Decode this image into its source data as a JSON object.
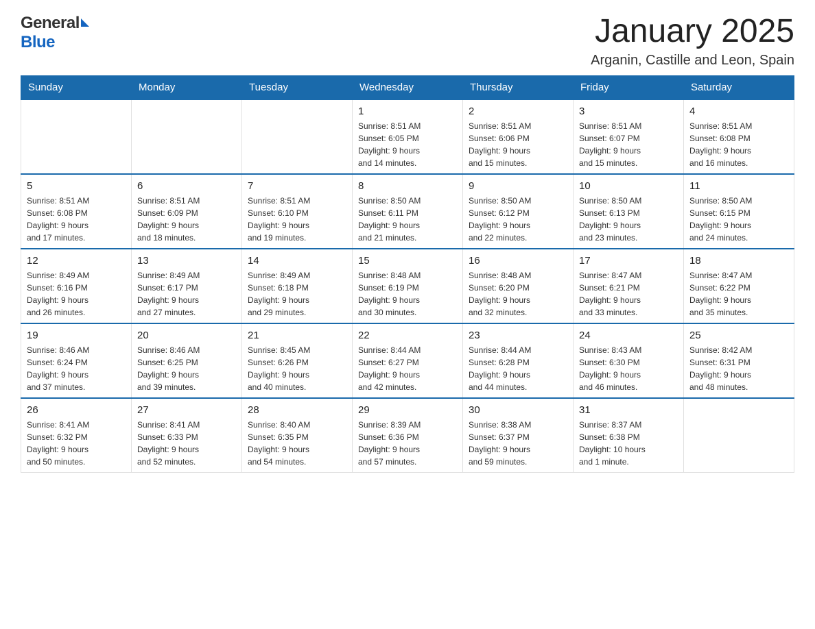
{
  "header": {
    "logo_general": "General",
    "logo_blue": "Blue",
    "title": "January 2025",
    "subtitle": "Arganin, Castille and Leon, Spain"
  },
  "calendar": {
    "days_of_week": [
      "Sunday",
      "Monday",
      "Tuesday",
      "Wednesday",
      "Thursday",
      "Friday",
      "Saturday"
    ],
    "weeks": [
      [
        {
          "day": "",
          "info": ""
        },
        {
          "day": "",
          "info": ""
        },
        {
          "day": "",
          "info": ""
        },
        {
          "day": "1",
          "info": "Sunrise: 8:51 AM\nSunset: 6:05 PM\nDaylight: 9 hours\nand 14 minutes."
        },
        {
          "day": "2",
          "info": "Sunrise: 8:51 AM\nSunset: 6:06 PM\nDaylight: 9 hours\nand 15 minutes."
        },
        {
          "day": "3",
          "info": "Sunrise: 8:51 AM\nSunset: 6:07 PM\nDaylight: 9 hours\nand 15 minutes."
        },
        {
          "day": "4",
          "info": "Sunrise: 8:51 AM\nSunset: 6:08 PM\nDaylight: 9 hours\nand 16 minutes."
        }
      ],
      [
        {
          "day": "5",
          "info": "Sunrise: 8:51 AM\nSunset: 6:08 PM\nDaylight: 9 hours\nand 17 minutes."
        },
        {
          "day": "6",
          "info": "Sunrise: 8:51 AM\nSunset: 6:09 PM\nDaylight: 9 hours\nand 18 minutes."
        },
        {
          "day": "7",
          "info": "Sunrise: 8:51 AM\nSunset: 6:10 PM\nDaylight: 9 hours\nand 19 minutes."
        },
        {
          "day": "8",
          "info": "Sunrise: 8:50 AM\nSunset: 6:11 PM\nDaylight: 9 hours\nand 21 minutes."
        },
        {
          "day": "9",
          "info": "Sunrise: 8:50 AM\nSunset: 6:12 PM\nDaylight: 9 hours\nand 22 minutes."
        },
        {
          "day": "10",
          "info": "Sunrise: 8:50 AM\nSunset: 6:13 PM\nDaylight: 9 hours\nand 23 minutes."
        },
        {
          "day": "11",
          "info": "Sunrise: 8:50 AM\nSunset: 6:15 PM\nDaylight: 9 hours\nand 24 minutes."
        }
      ],
      [
        {
          "day": "12",
          "info": "Sunrise: 8:49 AM\nSunset: 6:16 PM\nDaylight: 9 hours\nand 26 minutes."
        },
        {
          "day": "13",
          "info": "Sunrise: 8:49 AM\nSunset: 6:17 PM\nDaylight: 9 hours\nand 27 minutes."
        },
        {
          "day": "14",
          "info": "Sunrise: 8:49 AM\nSunset: 6:18 PM\nDaylight: 9 hours\nand 29 minutes."
        },
        {
          "day": "15",
          "info": "Sunrise: 8:48 AM\nSunset: 6:19 PM\nDaylight: 9 hours\nand 30 minutes."
        },
        {
          "day": "16",
          "info": "Sunrise: 8:48 AM\nSunset: 6:20 PM\nDaylight: 9 hours\nand 32 minutes."
        },
        {
          "day": "17",
          "info": "Sunrise: 8:47 AM\nSunset: 6:21 PM\nDaylight: 9 hours\nand 33 minutes."
        },
        {
          "day": "18",
          "info": "Sunrise: 8:47 AM\nSunset: 6:22 PM\nDaylight: 9 hours\nand 35 minutes."
        }
      ],
      [
        {
          "day": "19",
          "info": "Sunrise: 8:46 AM\nSunset: 6:24 PM\nDaylight: 9 hours\nand 37 minutes."
        },
        {
          "day": "20",
          "info": "Sunrise: 8:46 AM\nSunset: 6:25 PM\nDaylight: 9 hours\nand 39 minutes."
        },
        {
          "day": "21",
          "info": "Sunrise: 8:45 AM\nSunset: 6:26 PM\nDaylight: 9 hours\nand 40 minutes."
        },
        {
          "day": "22",
          "info": "Sunrise: 8:44 AM\nSunset: 6:27 PM\nDaylight: 9 hours\nand 42 minutes."
        },
        {
          "day": "23",
          "info": "Sunrise: 8:44 AM\nSunset: 6:28 PM\nDaylight: 9 hours\nand 44 minutes."
        },
        {
          "day": "24",
          "info": "Sunrise: 8:43 AM\nSunset: 6:30 PM\nDaylight: 9 hours\nand 46 minutes."
        },
        {
          "day": "25",
          "info": "Sunrise: 8:42 AM\nSunset: 6:31 PM\nDaylight: 9 hours\nand 48 minutes."
        }
      ],
      [
        {
          "day": "26",
          "info": "Sunrise: 8:41 AM\nSunset: 6:32 PM\nDaylight: 9 hours\nand 50 minutes."
        },
        {
          "day": "27",
          "info": "Sunrise: 8:41 AM\nSunset: 6:33 PM\nDaylight: 9 hours\nand 52 minutes."
        },
        {
          "day": "28",
          "info": "Sunrise: 8:40 AM\nSunset: 6:35 PM\nDaylight: 9 hours\nand 54 minutes."
        },
        {
          "day": "29",
          "info": "Sunrise: 8:39 AM\nSunset: 6:36 PM\nDaylight: 9 hours\nand 57 minutes."
        },
        {
          "day": "30",
          "info": "Sunrise: 8:38 AM\nSunset: 6:37 PM\nDaylight: 9 hours\nand 59 minutes."
        },
        {
          "day": "31",
          "info": "Sunrise: 8:37 AM\nSunset: 6:38 PM\nDaylight: 10 hours\nand 1 minute."
        },
        {
          "day": "",
          "info": ""
        }
      ]
    ]
  }
}
